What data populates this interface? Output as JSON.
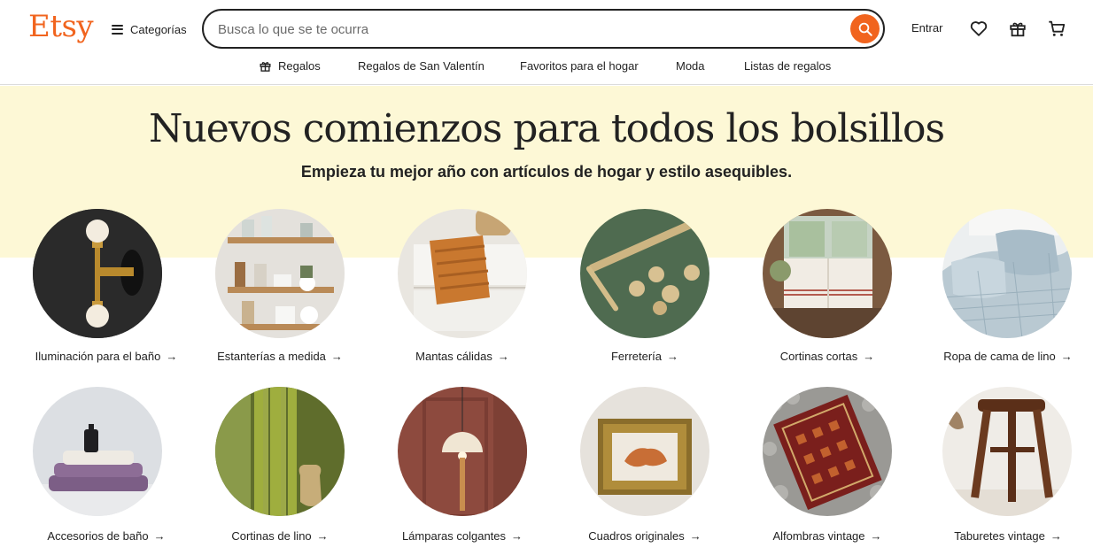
{
  "header": {
    "logo": "Etsy",
    "categories_label": "Categorías",
    "search": {
      "placeholder": "Busca lo que se te ocurra"
    },
    "sign_in": "Entrar",
    "accent_color": "#f1641e"
  },
  "subnav": {
    "items": [
      {
        "label": "Regalos",
        "icon": "gift-icon"
      },
      {
        "label": "Regalos de San Valentín"
      },
      {
        "label": "Favoritos para el hogar"
      },
      {
        "label": "Moda"
      },
      {
        "label": "Listas de regalos"
      }
    ]
  },
  "hero": {
    "title": "Nuevos comienzos para todos los bolsillos",
    "subtitle": "Empieza tu mejor año con artículos de hogar y estilo asequibles.",
    "background": "#fdf8d6"
  },
  "categories": {
    "row1": [
      {
        "label": "Iluminación para el baño"
      },
      {
        "label": "Estanterías a medida"
      },
      {
        "label": "Mantas cálidas"
      },
      {
        "label": "Ferretería"
      },
      {
        "label": "Cortinas cortas"
      },
      {
        "label": "Ropa de cama de lino"
      }
    ],
    "row2": [
      {
        "label": "Accesorios de baño"
      },
      {
        "label": "Cortinas de lino"
      },
      {
        "label": "Lámparas colgantes"
      },
      {
        "label": "Cuadros originales"
      },
      {
        "label": "Alfombras vintage"
      },
      {
        "label": "Taburetes vintage"
      }
    ],
    "arrow": "→"
  }
}
